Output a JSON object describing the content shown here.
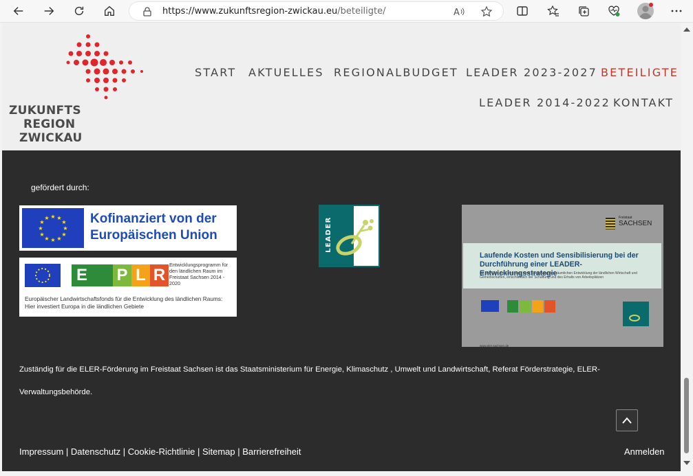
{
  "browser": {
    "url_host": "https://www.zukunftsregion-zwickau.eu",
    "url_path": "/beteiligte/",
    "icons": [
      "back-icon",
      "forward-icon",
      "refresh-icon",
      "home-icon",
      "lock-icon",
      "read-aloud-icon",
      "favorite-star-icon",
      "split-screen-icon",
      "favorites-icon",
      "collections-icon",
      "browser-essentials-icon",
      "profile-avatar",
      "more-icon"
    ]
  },
  "header": {
    "logo_lines": [
      "ZUKUNFTS",
      "REGION",
      "ZWICKAU"
    ],
    "nav": [
      {
        "label": "START",
        "active": false
      },
      {
        "label": "AKTUELLES",
        "active": false
      },
      {
        "label": "REGIONALBUDGET",
        "active": false
      },
      {
        "label": "LEADER 2023-2027",
        "active": false
      },
      {
        "label": "BETEILIGTE",
        "active": true
      },
      {
        "label": "LEADER 2014-2022",
        "active": false
      },
      {
        "label": "KONTAKT",
        "active": false
      }
    ],
    "active_color": "#c0392b"
  },
  "footer": {
    "gefoerdert": "gefördert durch:",
    "eu_banner": {
      "line1": "Kofinanziert von der",
      "line2": "Europäischen Union"
    },
    "eplr_banner": {
      "letters": [
        "E",
        "P",
        "L",
        "R"
      ],
      "letter_colors": [
        "#2e8b3a",
        "#7db93d",
        "#f4a21a",
        "#e2542a"
      ],
      "program": "Entwicklungsprogramm für den ländlichen Raum im Freistaat Sachsen 2014 - 2020",
      "fund": "Europäischer Landwirtschaftsfonds für die Entwicklung des ländlichen Raums: Hier investiert Europa in die ländlichen Gebiete"
    },
    "leader_logo": "LEADER",
    "plaque": {
      "state": "SACHSEN",
      "state_prefix": "Freistaat",
      "title": "Laufende Kosten und Sensibilisierung bei der Durchführung einer LEADER-Entwicklungsstrategie",
      "subtitle": "mit dem Ziel der Erreichung einer ausgewogenen räumlichen Entwicklung der ländlichen Wirtschaft und Gemeinschaften, einschließlich der Schaffung und des Erhalts von Arbeitsplätzen",
      "website": "www.eler.sachsen.de"
    },
    "zustaendig": "Zuständig für die ELER-Förderung im Freistaat Sachsen ist das Staatsministerium für Energie, Klimaschutz , Umwelt und Landwirtschaft, Referat Förderstrategie, ELER-Verwaltungsbehörde.",
    "links": [
      "Impressum",
      "Datenschutz",
      "Cookie-Richtlinie",
      "Sitemap",
      "Barrierefreiheit"
    ],
    "separator": " | ",
    "login": "Anmelden"
  }
}
